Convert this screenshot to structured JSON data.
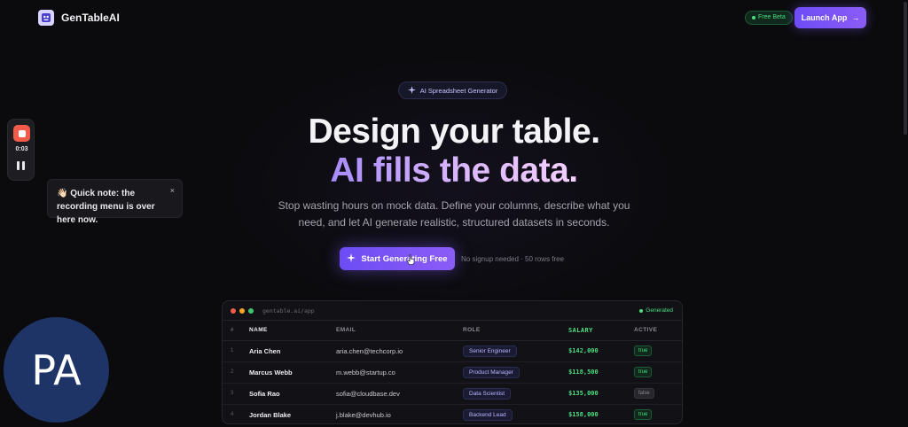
{
  "app": {
    "name": "GenTableAI"
  },
  "header": {
    "beta_badge": "Free Beta",
    "launch_button": "Launch App"
  },
  "recorder": {
    "time": "0:03",
    "tooltip": "👋🏻 Quick note: the recording menu is over here now.",
    "tooltip_close": "×"
  },
  "avatar": {
    "initials": "PA"
  },
  "hero": {
    "badge": "AI Spreadsheet Generator",
    "title_line1": "Design your table.",
    "title_line2": "AI fills the data.",
    "subtitle": "Stop wasting hours on mock data. Define your columns, describe what you need, and let AI generate realistic, structured datasets in seconds.",
    "cta": "Start Generating Free",
    "cta_note": "No signup needed · 50 rows free"
  },
  "preview": {
    "url": "gentable.ai/app",
    "status": "Generated",
    "columns": [
      "#",
      "NAME",
      "EMAIL",
      "ROLE",
      "SALARY",
      "ACTIVE"
    ],
    "rows": [
      {
        "num": "1",
        "name": "Aria Chen",
        "email": "aria.chen@techcorp.io",
        "role": "Senior Engineer",
        "salary": "$142,000",
        "active": "true"
      },
      {
        "num": "2",
        "name": "Marcus Webb",
        "email": "m.webb@startup.co",
        "role": "Product Manager",
        "salary": "$118,500",
        "active": "true"
      },
      {
        "num": "3",
        "name": "Sofia Rao",
        "email": "sofia@cloudbase.dev",
        "role": "Data Scientist",
        "salary": "$135,000",
        "active": "false"
      },
      {
        "num": "4",
        "name": "Jordan Blake",
        "email": "j.blake@devhub.io",
        "role": "Backend Lead",
        "salary": "$158,000",
        "active": "true"
      }
    ]
  },
  "colors": {
    "accent": "#7c5cf6",
    "success": "#4ade80",
    "background": "#0b0b0e"
  }
}
